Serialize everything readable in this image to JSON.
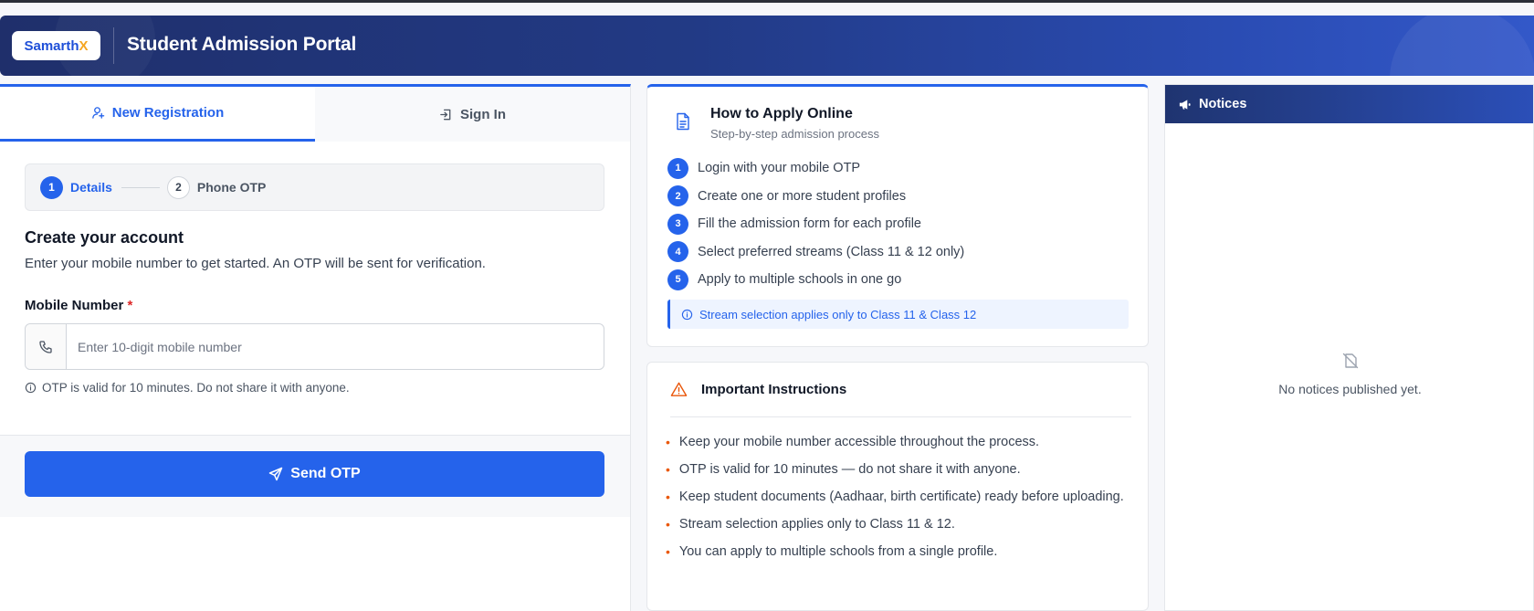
{
  "header": {
    "logo_main": "Samarth",
    "logo_accent": "X",
    "title": "Student Admission Portal"
  },
  "tabs": [
    {
      "label": "New Registration",
      "icon": "user-plus-icon",
      "active": true
    },
    {
      "label": "Sign In",
      "icon": "sign-in-icon",
      "active": false
    }
  ],
  "stepper": {
    "steps": [
      {
        "number": "1",
        "label": "Details",
        "active": true
      },
      {
        "number": "2",
        "label": "Phone OTP",
        "active": false
      }
    ]
  },
  "form": {
    "title": "Create your account",
    "subtitle": "Enter your mobile number to get started. An OTP will be sent for verification.",
    "mobile_label": "Mobile Number",
    "required_mark": "*",
    "mobile_placeholder": "Enter 10-digit mobile number",
    "mobile_value": "",
    "hint": "OTP is valid for 10 minutes. Do not share it with anyone.",
    "submit_label": "Send OTP"
  },
  "how_to_apply": {
    "title": "How to Apply Online",
    "subtitle": "Step-by-step admission process",
    "steps": [
      {
        "num": "1",
        "text": "Login with your mobile OTP"
      },
      {
        "num": "2",
        "text": "Create one or more student profiles"
      },
      {
        "num": "3",
        "text": "Fill the admission form for each profile"
      },
      {
        "num": "4",
        "text": "Select preferred streams (Class 11 & 12 only)"
      },
      {
        "num": "5",
        "text": "Apply to multiple schools in one go"
      }
    ],
    "note": "Stream selection applies only to Class 11 & Class 12"
  },
  "instructions": {
    "title": "Important Instructions",
    "items": [
      "Keep your mobile number accessible throughout the process.",
      "OTP is valid for 10 minutes — do not share it with anyone.",
      "Keep student documents (Aadhaar, birth certificate) ready before uploading.",
      "Stream selection applies only to Class 11 & 12.",
      "You can apply to multiple schools from a single profile."
    ]
  },
  "notices": {
    "title": "Notices",
    "empty_text": "No notices published yet."
  },
  "colors": {
    "accent": "#2563eb",
    "header_dark": "#1f2f6b",
    "warning": "#ea580c",
    "logo_accent": "#f5a623"
  }
}
